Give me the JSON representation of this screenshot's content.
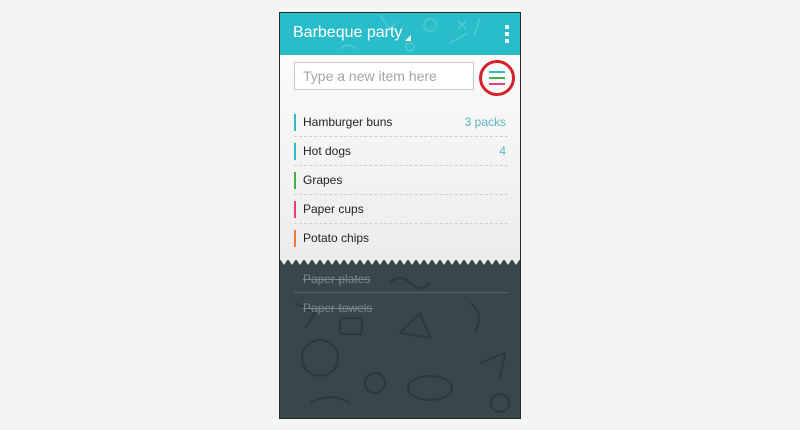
{
  "app": {
    "title": "Barbeque party"
  },
  "input": {
    "placeholder": "Type a new item here"
  },
  "items": [
    {
      "name": "Hamburger buns",
      "qty": "3 packs",
      "color": "#29bcc9"
    },
    {
      "name": "Hot dogs",
      "qty": "4",
      "color": "#29bcc9"
    },
    {
      "name": "Grapes",
      "qty": "",
      "color": "#3cb44b"
    },
    {
      "name": "Paper cups",
      "qty": "",
      "color": "#e8407a"
    },
    {
      "name": "Potato chips",
      "qty": "",
      "color": "#f07c3c"
    }
  ],
  "completed": [
    {
      "name": "Paper plates"
    },
    {
      "name": "Paper towels"
    }
  ],
  "menu_icon_colors": [
    "#29bcc9",
    "#3cb44b",
    "#e8407a"
  ],
  "colors": {
    "appbar": "#29bcc9",
    "highlight_ring": "#d4202a",
    "dark_background": "#37474a"
  }
}
